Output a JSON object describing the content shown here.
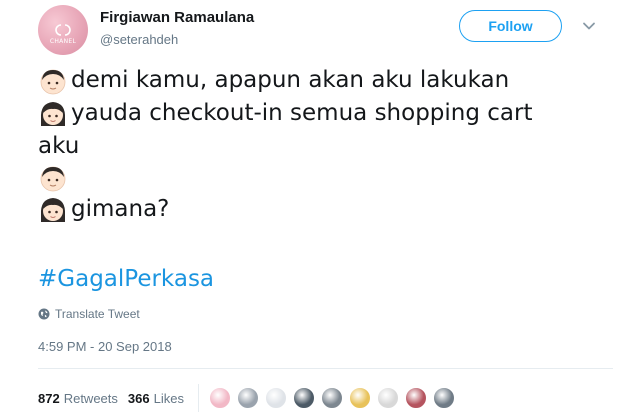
{
  "author": {
    "name": "Firgiawan Ramaulana",
    "handle": "@seterahdeh",
    "avatar_brand": "CHANEL"
  },
  "follow_label": "Follow",
  "tweet": {
    "lines": [
      {
        "emoji": "boy-emoji",
        "text": "demi kamu, apapun akan aku lakukan"
      },
      {
        "emoji": "girl-emoji",
        "text": "yauda checkout-in semua shopping cart"
      },
      {
        "emoji": "",
        "text": "aku"
      },
      {
        "emoji": "boy-emoji",
        "text": ""
      },
      {
        "emoji": "girl-emoji",
        "text": "gimana?"
      }
    ],
    "hashtag": "#GagalPerkasa"
  },
  "translate_label": "Translate Tweet",
  "timestamp": "4:59 PM - 20 Sep 2018",
  "stats": {
    "retweets_count": "872",
    "retweets_label": "Retweets",
    "likes_count": "366",
    "likes_label": "Likes"
  },
  "liker_avatar_colors": [
    "#f2b8c6",
    "#9aa3ad",
    "#dfe3e8",
    "#4c5a66",
    "#7d8790",
    "#e8c25a",
    "#d8d8d8",
    "#b5545f",
    "#6f7b86"
  ],
  "colors": {
    "accent": "#1da1f2",
    "hashtag": "#1b95e0",
    "secondary_text": "#657786"
  }
}
